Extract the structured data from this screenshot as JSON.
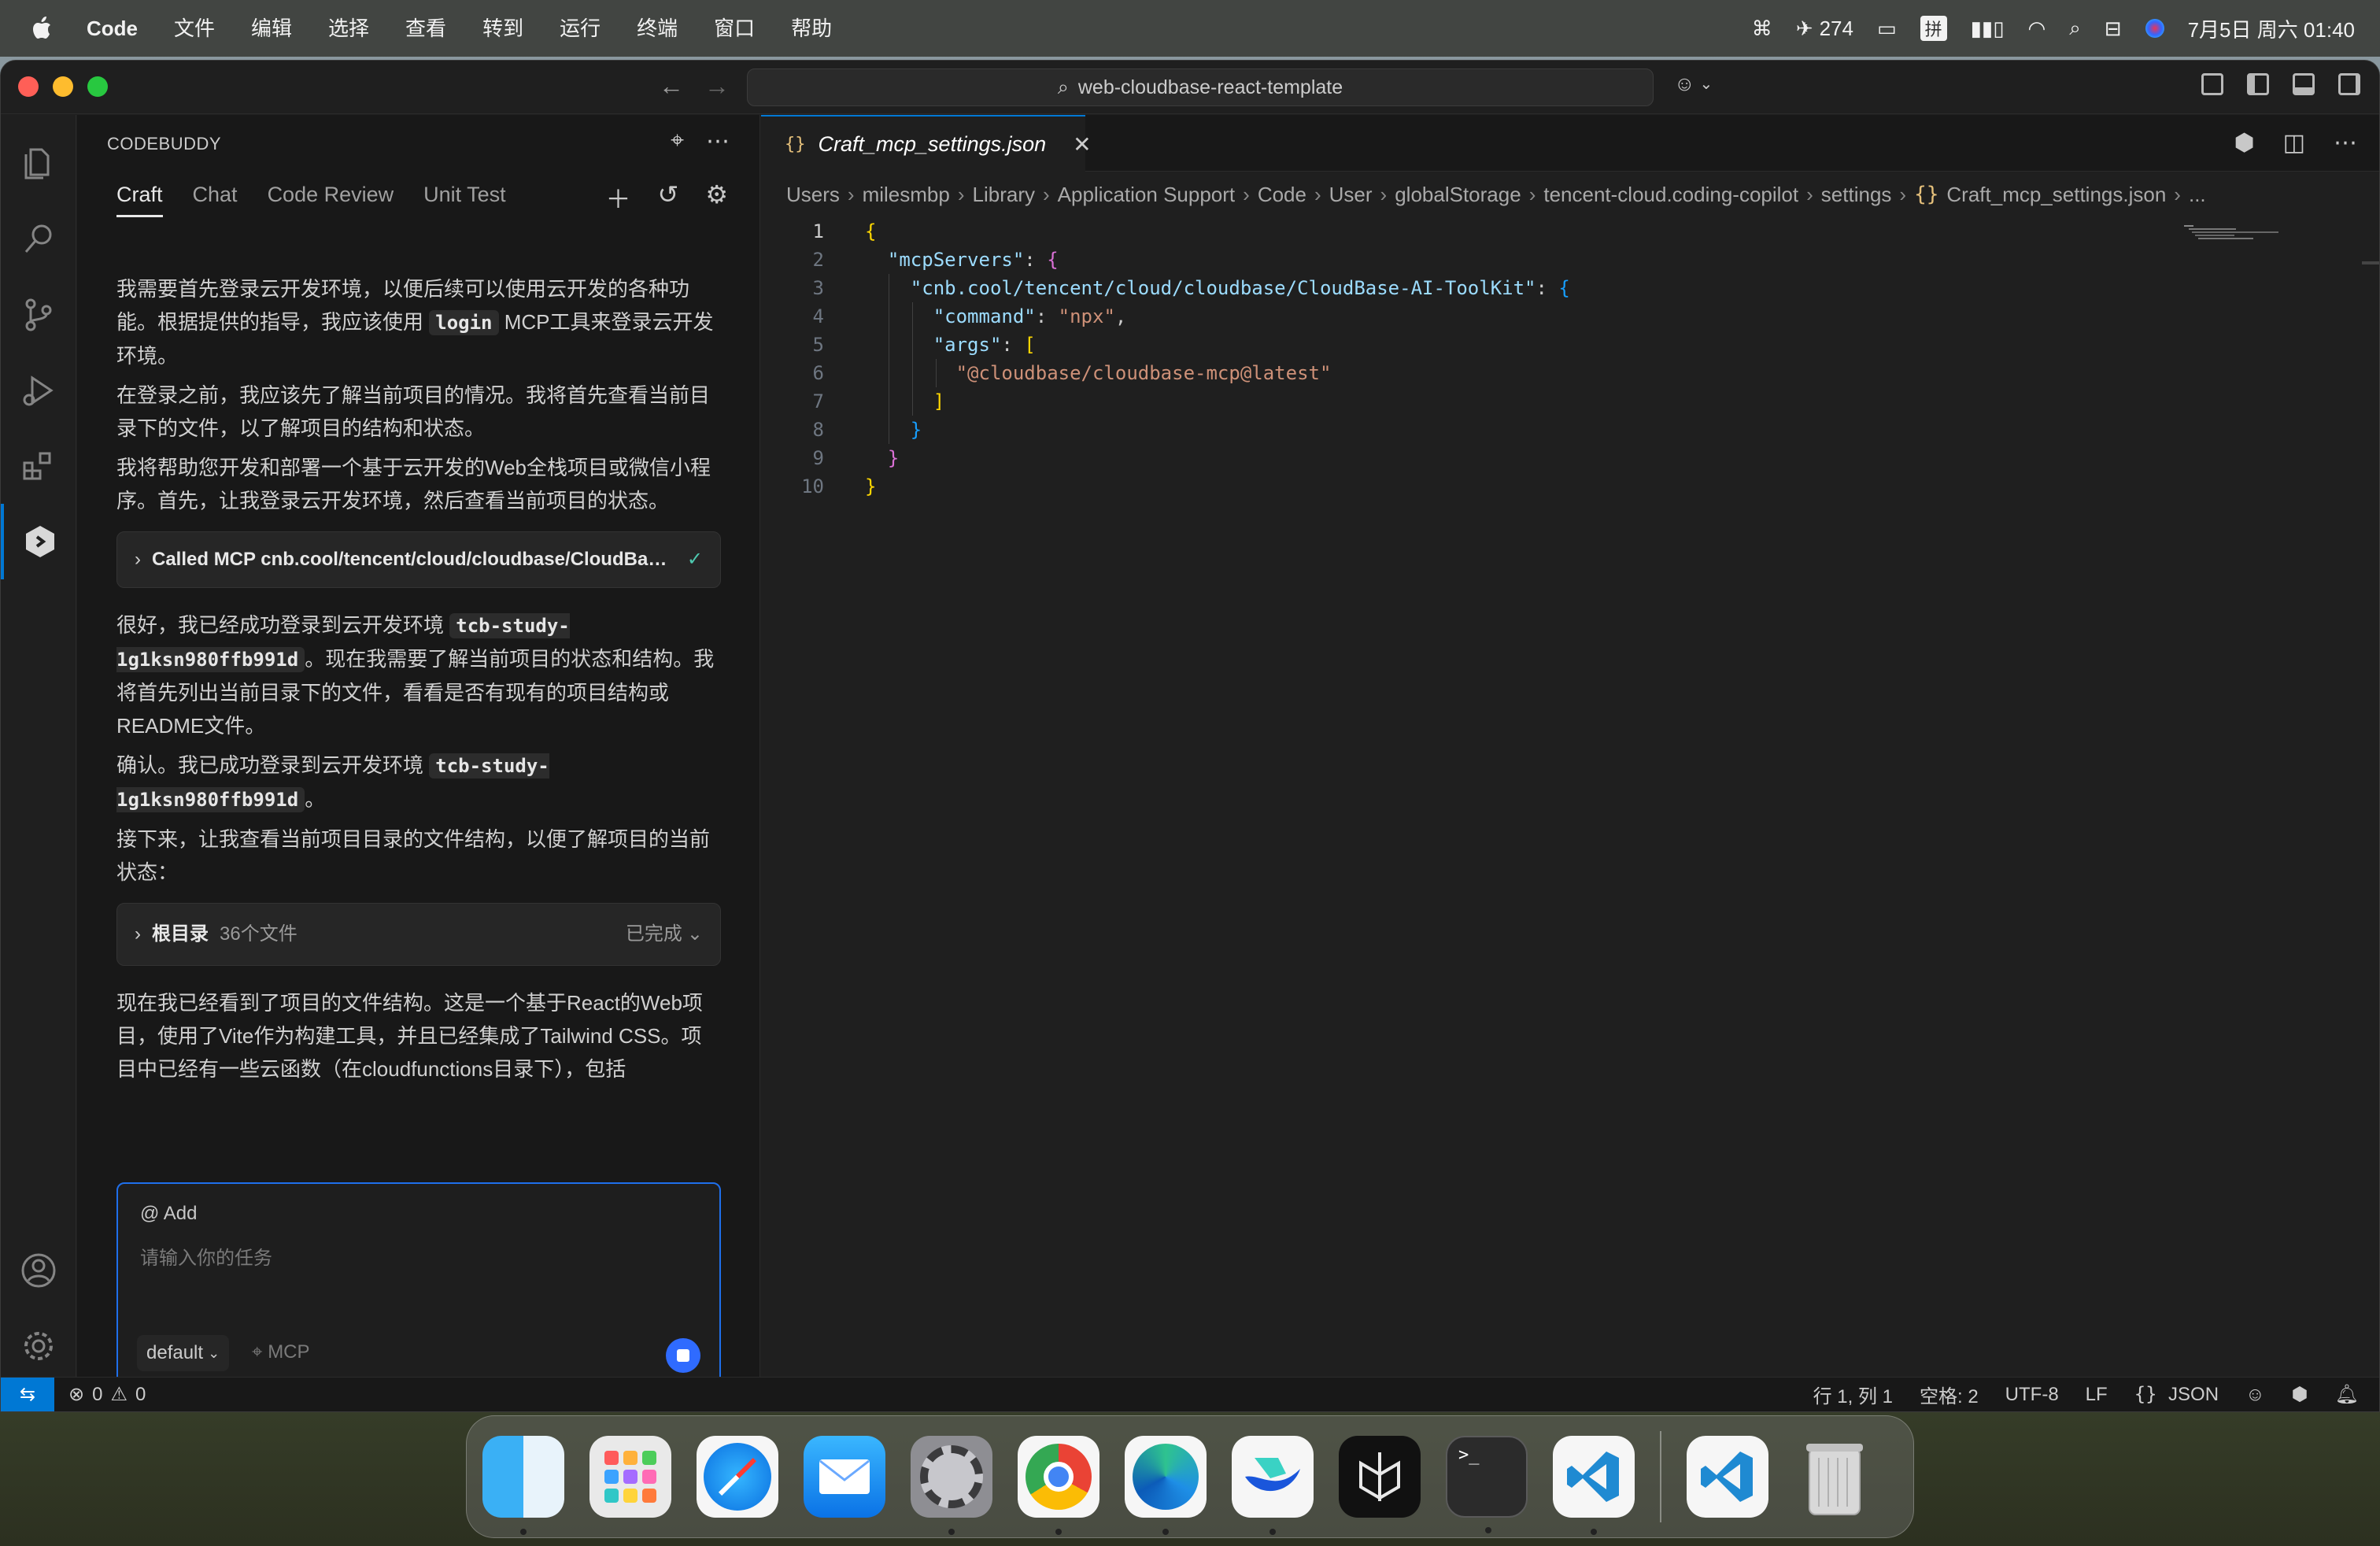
{
  "menubar": {
    "app_name": "Code",
    "items": [
      "文件",
      "编辑",
      "选择",
      "查看",
      "转到",
      "运行",
      "终端",
      "窗口",
      "帮助"
    ],
    "status_count": "274",
    "input_method": "拼",
    "datetime": "7月5日 周六 01:40"
  },
  "titlebar": {
    "search_text": "web-cloudbase-react-template"
  },
  "sidepanel": {
    "header": "CODEBUDDY",
    "tabs": [
      {
        "label": "Craft",
        "active": true
      },
      {
        "label": "Chat"
      },
      {
        "label": "Code Review"
      },
      {
        "label": "Unit Test"
      }
    ]
  },
  "chat": {
    "p1_before": "我需要首先登录云开发环境，以便后续可以使用云开发的各种功能。根据提供的指导，我应该使用",
    "p1_code": "login",
    "p1_after": "MCP工具来登录云开发环境。",
    "p2": "在登录之前，我应该先了解当前项目的情况。我将首先查看当前目录下的文件，以了解项目的结构和状态。",
    "p3": "我将帮助您开发和部署一个基于云开发的Web全栈项目或微信小程序。首先，让我登录云开发环境，然后查看当前项目的状态。",
    "call_mcp": "Called MCP cnb.cool/tencent/cloud/cloudbase/CloudBase-AI-ToolKit",
    "p4_before": "很好，我已经成功登录到云开发环境",
    "env_id": "tcb-study-1g1ksn980ffb991d",
    "p4_after": "。现在我需要了解当前项目的状态和结构。我将首先列出当前目录下的文件，看看是否有现有的项目结构或README文件。",
    "p5_before": "确认。我已成功登录到云开发环境",
    "p5_after": "。",
    "p6": "接下来，让我查看当前项目目录的文件结构，以便了解项目的当前状态：",
    "dir_title": "根目录",
    "dir_count": "36个文件",
    "dir_status": "已完成",
    "p7": "现在我已经看到了项目的文件结构。这是一个基于React的Web项目，使用了Vite作为构建工具，并且已经集成了Tailwind CSS。项目中已经有一些云函数（在cloudfunctions目录下），包括"
  },
  "input": {
    "add_label": "@ Add",
    "placeholder": "请输入你的任务",
    "model": "default",
    "mcp_label": "MCP"
  },
  "editor": {
    "tab_name": "Craft_mcp_settings.json",
    "breadcrumb": [
      "Users",
      "milesmbp",
      "Library",
      "Application Support",
      "Code",
      "User",
      "globalStorage",
      "tencent-cloud.coding-copilot",
      "settings"
    ],
    "breadcrumb_file": "Craft_mcp_settings.json",
    "breadcrumb_more": "...",
    "code": {
      "key_mcpServers": "\"mcpServers\"",
      "key_server": "\"cnb.cool/tencent/cloud/cloudbase/CloudBase-AI-ToolKit\"",
      "key_command": "\"command\"",
      "val_command": "\"npx\"",
      "key_args": "\"args\"",
      "val_arg": "\"@cloudbase/cloudbase-mcp@latest\""
    }
  },
  "statusbar": {
    "errors": "0",
    "warnings": "0",
    "position": "行 1, 列 1",
    "spaces": "空格: 2",
    "encoding": "UTF-8",
    "eol": "LF",
    "language": "JSON"
  },
  "dock": {
    "apps": [
      "finder",
      "launchpad",
      "safari",
      "mail",
      "system-settings",
      "chrome",
      "edge",
      "feishu",
      "perplexity",
      "terminal",
      "vscode",
      "vscode-insiders",
      "trash"
    ]
  }
}
